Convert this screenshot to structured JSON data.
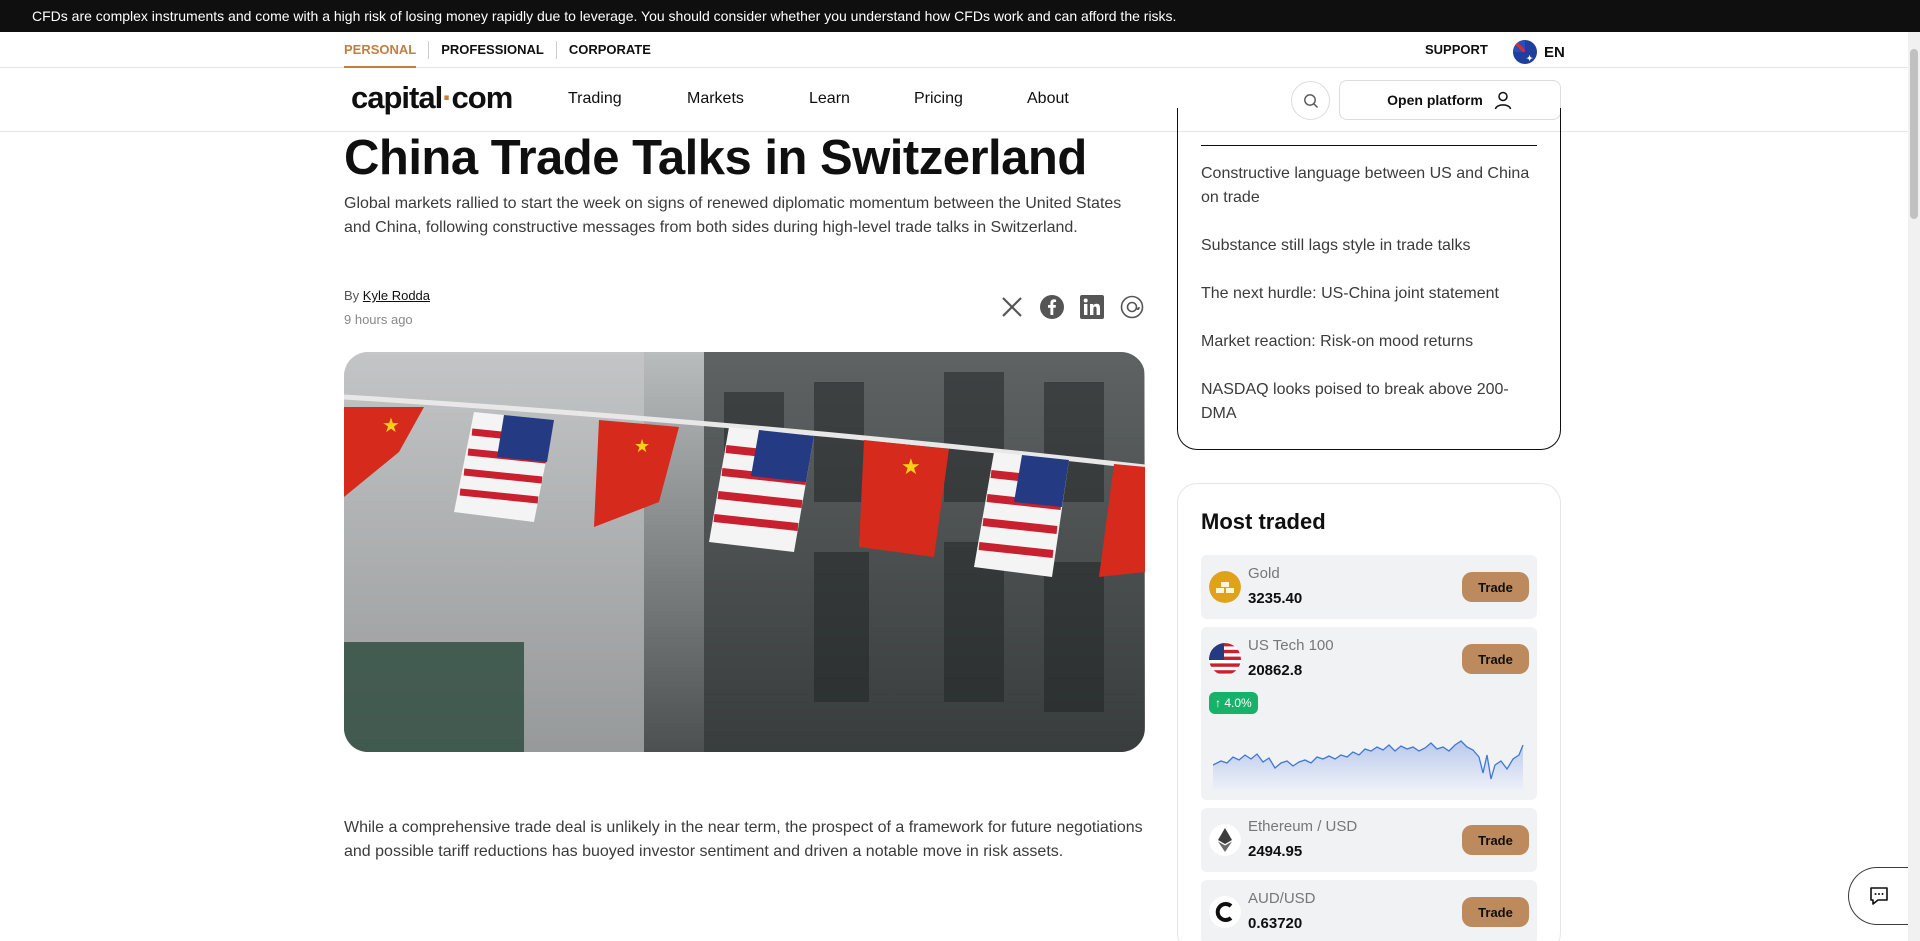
{
  "risk_banner": "CFDs are complex instruments and come with a high risk of losing money rapidly due to leverage. You should consider whether you understand how CFDs work and can afford the risks.",
  "topbar": {
    "segments": [
      "PERSONAL",
      "PROFESSIONAL",
      "CORPORATE"
    ],
    "active_segment": "PERSONAL",
    "support": "SUPPORT",
    "language": "EN",
    "language_flag_icon": "australia-flag-icon"
  },
  "navbar": {
    "logo_left": "capital",
    "logo_dot": "·",
    "logo_right": "com",
    "links": [
      "Trading",
      "Markets",
      "Learn",
      "Pricing",
      "About"
    ],
    "open_platform": "Open platform",
    "accent_color": "#c67e3c"
  },
  "article": {
    "title": "China Trade Talks in Switzerland",
    "lead": "Global markets rallied to start the week on signs of renewed diplomatic momentum between the United States and China, following constructive messages from both sides during high-level trade talks in Switzerland.",
    "by_prefix": "By ",
    "author": "Kyle Rodda",
    "time_ago": "9 hours ago",
    "share_icons": [
      "x-icon",
      "facebook-icon",
      "linkedin-icon",
      "threads-icon"
    ],
    "body": "While a comprehensive trade deal is unlikely in the near term, the prospect of a framework for future negotiations and possible tariff reductions has buoyed investor sentiment and driven a notable move in risk assets."
  },
  "toc": {
    "items": [
      "Constructive language between US and China on trade",
      "Substance still lags style in trade talks",
      "The next hurdle: US-China joint statement",
      "Market reaction: Risk-on mood returns",
      "NASDAQ looks poised to break above 200-DMA"
    ]
  },
  "most_traded": {
    "title": "Most traded",
    "trade_label": "Trade",
    "items": [
      {
        "name": "Gold",
        "price": "3235.40",
        "icon": "gold-bars-icon"
      },
      {
        "name": "US Tech 100",
        "price": "20862.8",
        "icon": "us-flag-icon",
        "change": "↑ 4.0%"
      },
      {
        "name": "Ethereum / USD",
        "price": "2494.95",
        "icon": "ethereum-icon"
      },
      {
        "name": "AUD/USD",
        "price": "0.63720",
        "icon": "aud-icon"
      }
    ],
    "positive_color": "#17b26a",
    "trade_button_color": "#bc8a5c"
  }
}
